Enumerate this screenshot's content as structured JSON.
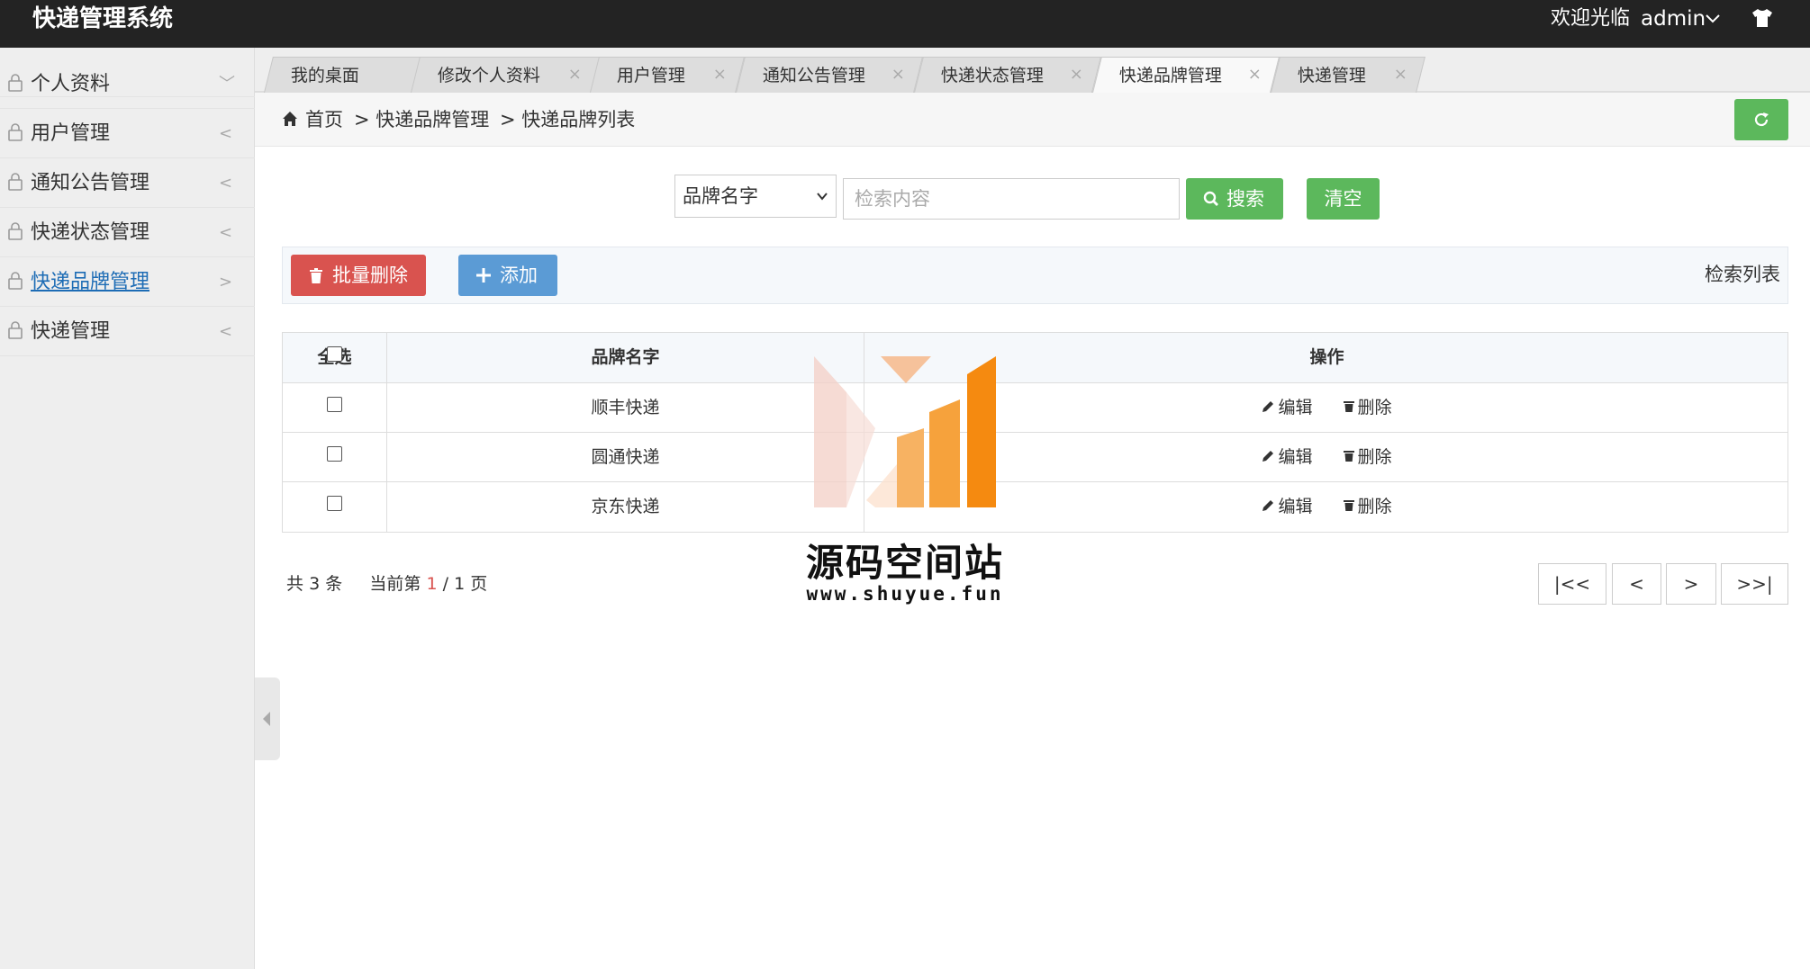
{
  "app": {
    "title": "快递管理系统",
    "welcome": "欢迎光临",
    "user": "admin"
  },
  "sidebar": {
    "items": [
      {
        "label": "个人资料",
        "arrow": "﹀"
      },
      {
        "label": "用户管理",
        "arrow": "<"
      },
      {
        "label": "通知公告管理",
        "arrow": "<"
      },
      {
        "label": "快递状态管理",
        "arrow": "<"
      },
      {
        "label": "快递品牌管理",
        "arrow": ">"
      },
      {
        "label": "快递管理",
        "arrow": "<"
      }
    ]
  },
  "tabs": [
    {
      "label": "我的桌面",
      "close": ""
    },
    {
      "label": "修改个人资料",
      "close": "×"
    },
    {
      "label": "用户管理",
      "close": "×"
    },
    {
      "label": "通知公告管理",
      "close": "×"
    },
    {
      "label": "快递状态管理",
      "close": "×"
    },
    {
      "label": "快递品牌管理",
      "close": "×"
    },
    {
      "label": "快递管理",
      "close": "×"
    }
  ],
  "breadcrumb": {
    "home": "首页",
    "level1": "> 快递品牌管理",
    "level2": "> 快递品牌列表"
  },
  "search": {
    "field_selected": "品牌名字",
    "placeholder": "检索内容",
    "search_label": "搜索",
    "clear_label": "清空"
  },
  "toolbar": {
    "batch_delete_label": "批量删除",
    "add_label": "添加",
    "list_title": "检索列表"
  },
  "table": {
    "headers": {
      "select_all": "全选",
      "brand_name": "品牌名字",
      "actions": "操作"
    },
    "rows": [
      {
        "brand": "顺丰快递"
      },
      {
        "brand": "圆通快递"
      },
      {
        "brand": "京东快递"
      }
    ],
    "edit_label": "编辑",
    "delete_label": "删除"
  },
  "pagination": {
    "total_prefix": "共",
    "total": "3",
    "total_suffix": "条",
    "current_prefix": "当前第",
    "current": "1",
    "sep": "/",
    "pages": "1",
    "pages_suffix": "页",
    "first": "|<<",
    "prev": "<",
    "next": ">",
    "last": ">>|"
  },
  "watermark": {
    "name": "源码空间站",
    "url": "www.shuyue.fun"
  },
  "colors": {
    "topbar": "#232323",
    "green": "#5cb85c",
    "red": "#d9534f",
    "blue": "#5b9bd5",
    "link": "#1d6cb5"
  }
}
